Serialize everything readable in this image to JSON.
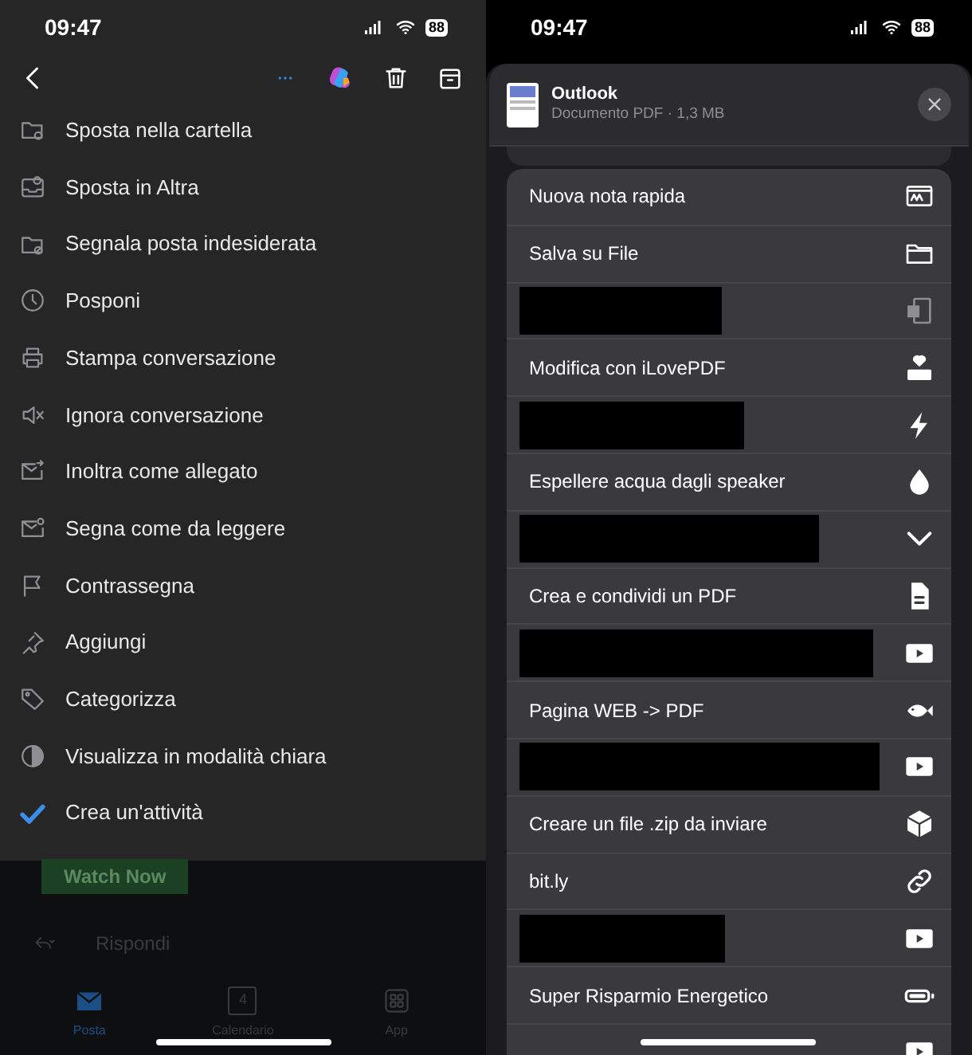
{
  "left": {
    "status_bar": {
      "time": "09:47",
      "battery": "88"
    },
    "menu": [
      {
        "label": "Sposta nella cartella"
      },
      {
        "label": "Sposta in Altra"
      },
      {
        "label": "Segnala posta indesiderata"
      },
      {
        "label": "Posponi"
      },
      {
        "label": "Stampa conversazione"
      },
      {
        "label": "Ignora conversazione"
      },
      {
        "label": "Inoltra come allegato"
      },
      {
        "label": "Segna come da leggere"
      },
      {
        "label": "Contrassegna"
      },
      {
        "label": "Aggiungi"
      },
      {
        "label": "Categorizza"
      },
      {
        "label": "Visualizza in modalità chiara"
      },
      {
        "label": "Crea un'attività"
      }
    ],
    "watch_button": "Watch Now",
    "reply": "Rispondi",
    "calendar_day": "4",
    "tabs": [
      {
        "label": "Posta",
        "selected": true
      },
      {
        "label": "Calendario",
        "selected": false
      },
      {
        "label": "App",
        "selected": false
      }
    ]
  },
  "right": {
    "status_bar": {
      "time": "09:47",
      "battery": "88"
    },
    "share_header": {
      "title": "Outlook",
      "subtitle": "Documento PDF · 1,3 MB"
    },
    "actions": [
      {
        "kind": "action",
        "label": "Nuova nota rapida"
      },
      {
        "kind": "action",
        "label": "Salva su File"
      },
      {
        "kind": "redacted"
      },
      {
        "kind": "action",
        "label": "Modifica con iLovePDF"
      },
      {
        "kind": "redacted"
      },
      {
        "kind": "action",
        "label": "Espellere acqua dagli speaker"
      },
      {
        "kind": "redacted"
      },
      {
        "kind": "action",
        "label": "Crea e condividi un PDF"
      },
      {
        "kind": "redacted"
      },
      {
        "kind": "action",
        "label": "Pagina WEB -> PDF"
      },
      {
        "kind": "redacted"
      },
      {
        "kind": "action",
        "label": "Creare un file .zip da inviare"
      },
      {
        "kind": "action",
        "label": "bit.ly"
      },
      {
        "kind": "redacted"
      },
      {
        "kind": "action",
        "label": "Super Risparmio Energetico"
      },
      {
        "kind": "partial"
      }
    ]
  }
}
